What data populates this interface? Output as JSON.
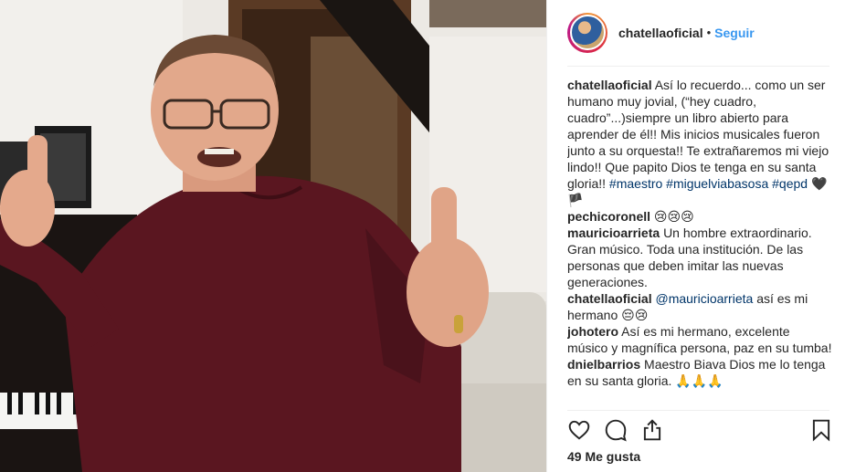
{
  "post": {
    "username": "chatellaoficial",
    "separator": "•",
    "follow_label": "Seguir"
  },
  "comments": [
    {
      "user": "chatellaoficial",
      "text": "Así lo recuerdo... como un ser humano muy jovial, (“hey cuadro, cuadro”...)siempre un libro abierto para aprender de él!! Mis inicios musicales fueron junto a su orquesta!! Te extrañaremos mi viejo lindo!! Que papito Dios te tenga en su santa gloria!!",
      "tags": "#maestro #miguelviabasosa #qepd",
      "emoji": "🖤🏴"
    },
    {
      "user": "pechicoronell",
      "text": "",
      "emoji": "😢😢😢"
    },
    {
      "user": "mauricioarrieta",
      "text": "Un hombre extraordinario. Gran músico. Toda una institución. De las personas que deben imitar las nuevas generaciones.",
      "emoji": ""
    },
    {
      "user": "chatellaoficial",
      "mention": "@mauricioarrieta",
      "text": "así es mi hermano",
      "emoji": "😔😢"
    },
    {
      "user": "johotero",
      "text": "Así es mi hermano, excelente músico y magnífica persona, paz en su tumba!",
      "emoji": ""
    },
    {
      "user": "dnielbarrios",
      "text": "Maestro Biava Dios me lo tenga en su santa gloria.",
      "emoji": "🙏🙏🙏"
    }
  ],
  "icons": {
    "like": "heart-icon",
    "comment": "comment-bubble-icon",
    "share": "share-icon",
    "save": "bookmark-icon"
  },
  "likes_label": "49 Me gusta",
  "colors": {
    "link": "#3897f0",
    "hashtag": "#003569",
    "text": "#262626"
  }
}
